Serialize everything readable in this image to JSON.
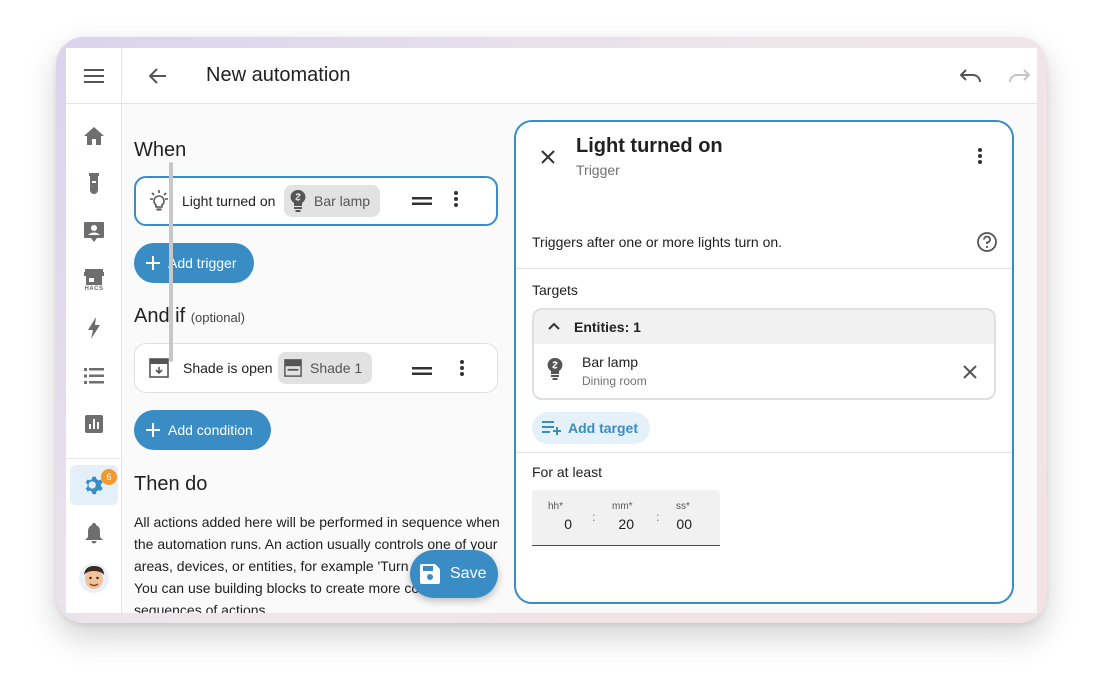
{
  "app": {
    "title": "New automation"
  },
  "sidebar": {
    "items": [
      {
        "name": "home"
      },
      {
        "name": "energy"
      },
      {
        "name": "person"
      },
      {
        "name": "hacs",
        "label": "HACS"
      },
      {
        "name": "lightning"
      },
      {
        "name": "logbook"
      },
      {
        "name": "history"
      }
    ],
    "settings_badge": "6"
  },
  "editor": {
    "when_title": "When",
    "trigger": {
      "label": "Light turned on",
      "chip": "Bar lamp"
    },
    "add_trigger_label": "Add trigger",
    "andif_title": "And if",
    "andif_optional": "(optional)",
    "condition": {
      "label": "Shade is open",
      "chip": "Shade 1"
    },
    "add_condition_label": "Add condition",
    "then_title": "Then do",
    "then_desc": "All actions added here will be performed in sequence when the automation runs. An action usually controls one of your areas, devices, or entities, for example 'Turn on the lights'. You can use building blocks to create more complex sequences of actions.",
    "save_label": "Save"
  },
  "panel": {
    "title": "Light turned on",
    "subtitle": "Trigger",
    "description": "Triggers after one or more lights turn on.",
    "targets_label": "Targets",
    "entities_header": "Entities: 1",
    "entity": {
      "name": "Bar lamp",
      "area": "Dining room"
    },
    "add_target_label": "Add target",
    "for_label": "For at least",
    "duration": {
      "hh_label": "hh*",
      "hh": "0",
      "mm_label": "mm*",
      "mm": "20",
      "ss_label": "ss*",
      "ss": "00",
      "sep": ":"
    }
  },
  "colors": {
    "accent": "#3a8dc4",
    "badge": "#f2992e",
    "chip": "#e2e2e2",
    "accent_soft": "#e4f1f9"
  }
}
